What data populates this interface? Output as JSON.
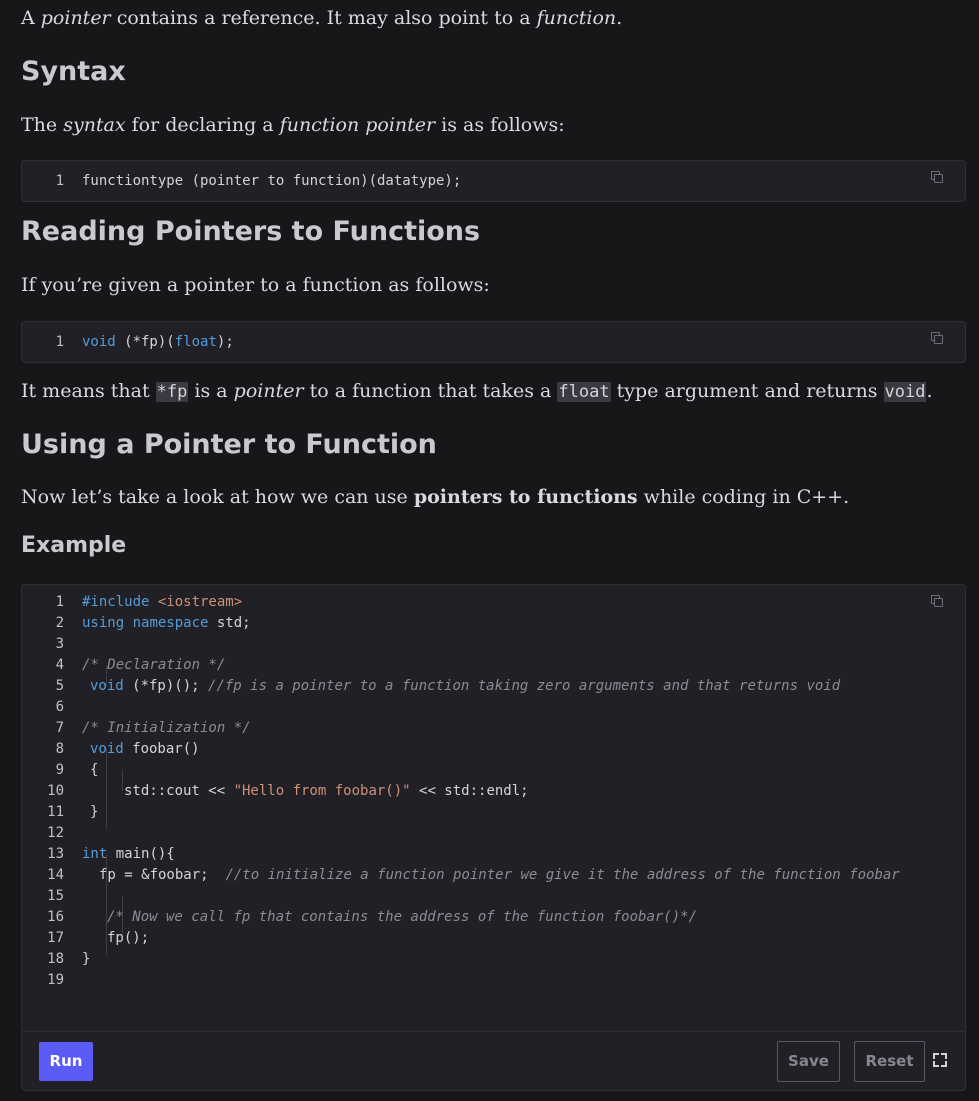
{
  "intro": {
    "a": "A ",
    "b": "pointer",
    "c": " contains a reference. It may also point to a ",
    "d": "function",
    "e": "."
  },
  "h_syntax": "Syntax",
  "syntax_p": {
    "a": "The ",
    "b": "syntax",
    "c": " for declaring a ",
    "d": "function pointer",
    "e": " is as follows:"
  },
  "code1": {
    "line": "1",
    "text": "functiontype (pointer to function)(datatype);"
  },
  "h_reading": "Reading Pointers to Functions",
  "reading_p": "If you’re given a pointer to a function as follows:",
  "code2": {
    "line": "1",
    "kw1": "void",
    "mid": " (*fp)(",
    "kw2": "float",
    "end": ");"
  },
  "means_p": {
    "a": "It means that ",
    "b": "*fp",
    "c": " is a ",
    "d": "pointer",
    "e": " to a function that takes a ",
    "f": "float",
    "g": " type argument and returns ",
    "h": "void",
    "i": "."
  },
  "h_using": "Using a Pointer to Function",
  "using_p": {
    "a": "Now let’s take a look at how we can use ",
    "b": "pointers to functions",
    "c": " while coding in C++."
  },
  "h_example": "Example",
  "example": {
    "line_numbers": [
      "1",
      "2",
      "3",
      "4",
      "5",
      "6",
      "7",
      "8",
      "9",
      "10",
      "11",
      "12",
      "13",
      "14",
      "15",
      "16",
      "17",
      "18",
      "19"
    ],
    "l1": {
      "a": "#include ",
      "b": "<iostream>"
    },
    "l2": {
      "a": "using",
      "b": " ",
      "c": "namespace",
      "d": " std;"
    },
    "l4": "/* Declaration */",
    "l5": {
      "a": "void",
      "b": " (*fp)(); ",
      "c": "//fp is a pointer to a function taking zero arguments and that returns void"
    },
    "l7": "/* Initialization */",
    "l8": {
      "a": "void",
      "b": " foobar()"
    },
    "l9": "{",
    "l10": {
      "a": "std::cout << ",
      "b": "\"Hello from foobar()\"",
      "c": " << std::endl;"
    },
    "l11": "}",
    "l13": {
      "a": "int",
      "b": " main(){"
    },
    "l14": {
      "a": "fp = &foobar;  ",
      "b": "//to initialize a function pointer we give it the address of the function foobar"
    },
    "l16": "/* Now we call fp that contains the address of the function foobar()*/",
    "l17": "fp();",
    "l18": "}"
  },
  "buttons": {
    "run": "Run",
    "save": "Save",
    "reset": "Reset"
  },
  "icons": {
    "copy": "copy-icon",
    "fullscreen": "fullscreen-icon"
  },
  "colors": {
    "run_button": "#5b5cf6",
    "keyword": "#569cd6",
    "string": "#ce9178",
    "comment": "#8b8b93"
  }
}
